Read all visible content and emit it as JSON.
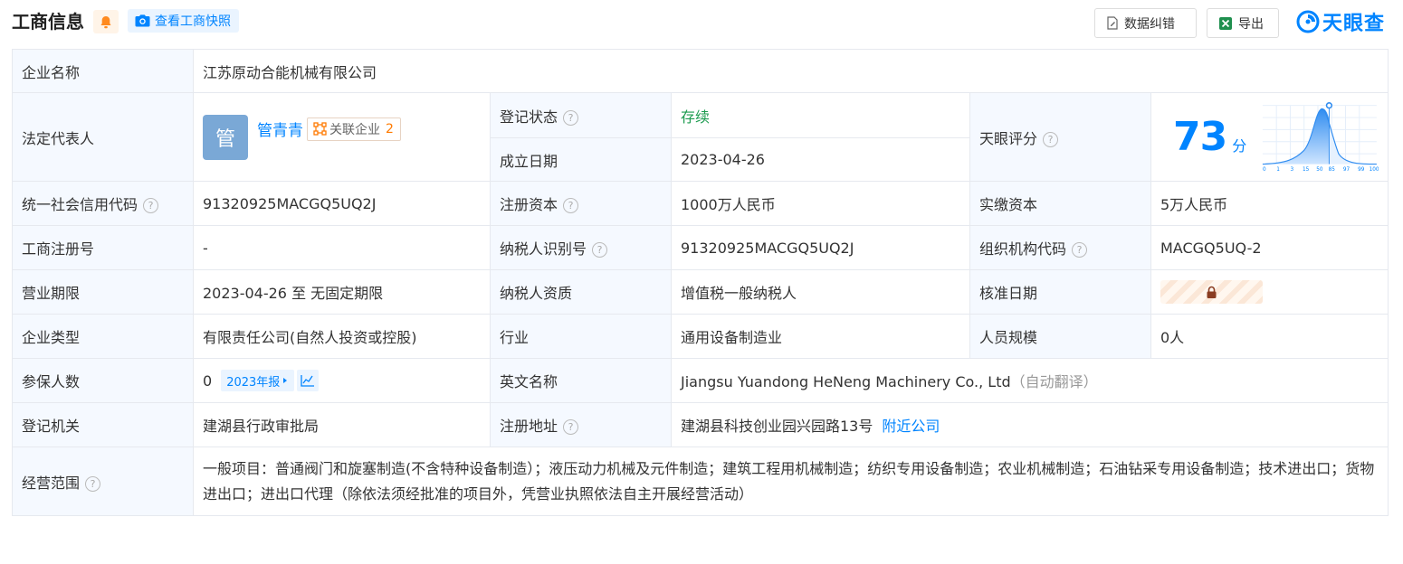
{
  "header": {
    "title": "工商信息",
    "snapshot_label": "查看工商快照",
    "error_label": "数据纠错",
    "export_label": "导出",
    "logo_text": "天眼查"
  },
  "colors": {
    "accent": "#0084ff",
    "status_green": "#1c9b4f",
    "warning_orange": "#ff7a00"
  },
  "company_name": {
    "label": "企业名称",
    "value": "江苏原动合能机械有限公司"
  },
  "legal_rep": {
    "label": "法定代表人",
    "avatar_char": "管",
    "name": "管青青",
    "related_label": "关联企业",
    "related_count": "2"
  },
  "reg_status": {
    "label": "登记状态",
    "value": "存续"
  },
  "found_date": {
    "label": "成立日期",
    "value": "2023-04-26"
  },
  "tianyan_score": {
    "label": "天眼评分",
    "value": "73",
    "unit": "分",
    "axis_ticks": [
      "0",
      "1",
      "3",
      "15",
      "50",
      "85",
      "97",
      "99",
      "100"
    ]
  },
  "credit_code": {
    "label": "统一社会信用代码",
    "value": "91320925MACGQ5UQ2J"
  },
  "reg_capital": {
    "label": "注册资本",
    "value": "1000万人民币"
  },
  "paid_capital": {
    "label": "实缴资本",
    "value": "5万人民币"
  },
  "reg_number": {
    "label": "工商注册号",
    "value": "-"
  },
  "taxpayer_id": {
    "label": "纳税人识别号",
    "value": "91320925MACGQ5UQ2J"
  },
  "org_code": {
    "label": "组织机构代码",
    "value": "MACGQ5UQ-2"
  },
  "biz_term": {
    "label": "营业期限",
    "value": "2023-04-26 至 无固定期限"
  },
  "taxpayer_qual": {
    "label": "纳税人资质",
    "value": "增值税一般纳税人"
  },
  "approval_date": {
    "label": "核准日期"
  },
  "company_type": {
    "label": "企业类型",
    "value": "有限责任公司(自然人投资或控股)"
  },
  "industry": {
    "label": "行业",
    "value": "通用设备制造业"
  },
  "staff_size": {
    "label": "人员规模",
    "value": "0人"
  },
  "insured": {
    "label": "参保人数",
    "value": "0",
    "report_label": "2023年报"
  },
  "english_name": {
    "label": "英文名称",
    "value": "Jiangsu Yuandong HeNeng Machinery Co., Ltd",
    "note": "（自动翻译）"
  },
  "reg_authority": {
    "label": "登记机关",
    "value": "建湖县行政审批局"
  },
  "reg_address": {
    "label": "注册地址",
    "value": "建湖县科技创业园兴园路13号",
    "nearby_label": "附近公司"
  },
  "biz_scope": {
    "label": "经营范围",
    "value": "一般项目：普通阀门和旋塞制造(不含特种设备制造）；液压动力机械及元件制造；建筑工程用机械制造；纺织专用设备制造；农业机械制造；石油钻采专用设备制造；技术进出口；货物进出口；进出口代理（除依法须经批准的项目外，凭营业执照依法自主开展经营活动）"
  }
}
